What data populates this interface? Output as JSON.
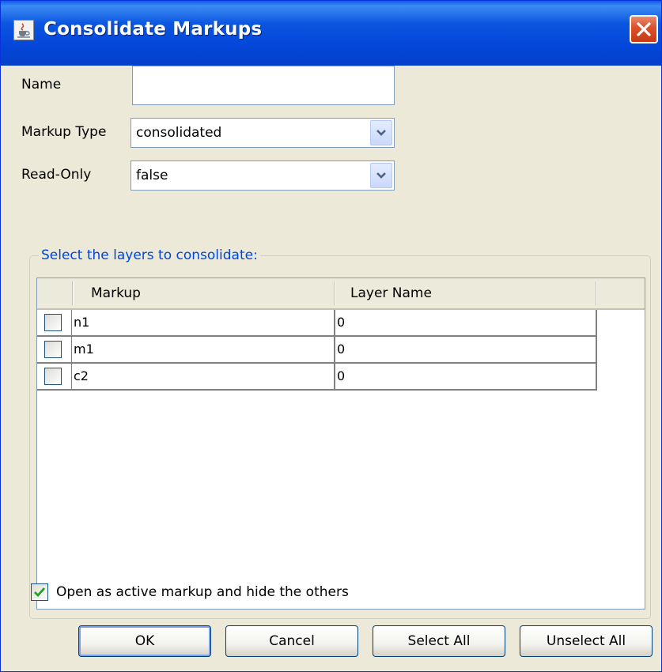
{
  "window": {
    "title": "Consolidate Markups"
  },
  "form": {
    "name_label": "Name",
    "name_value": "",
    "markup_type_label": "Markup Type",
    "markup_type_value": "consolidated",
    "read_only_label": "Read-Only",
    "read_only_value": "false"
  },
  "layers": {
    "group_title": "Select the layers to consolidate:",
    "columns": [
      "Markup",
      "Layer Name"
    ],
    "rows": [
      {
        "checked": false,
        "markup": "n1",
        "layer": "0"
      },
      {
        "checked": false,
        "markup": "m1",
        "layer": "0"
      },
      {
        "checked": false,
        "markup": "c2",
        "layer": "0"
      }
    ]
  },
  "options": {
    "open_active_label": "Open as active markup and hide the others",
    "open_active_checked": true
  },
  "buttons": {
    "ok": "OK",
    "cancel": "Cancel",
    "select_all": "Select All",
    "unselect_all": "Unselect All"
  },
  "colors": {
    "titlebar": "#0346D9",
    "close": "#D9512A",
    "group_title": "#0046D5",
    "check": "#21A121"
  },
  "icons": {
    "title": "java-cup-icon",
    "close": "close-icon",
    "dropdown": "chevron-down-icon",
    "check": "checkmark-icon"
  }
}
